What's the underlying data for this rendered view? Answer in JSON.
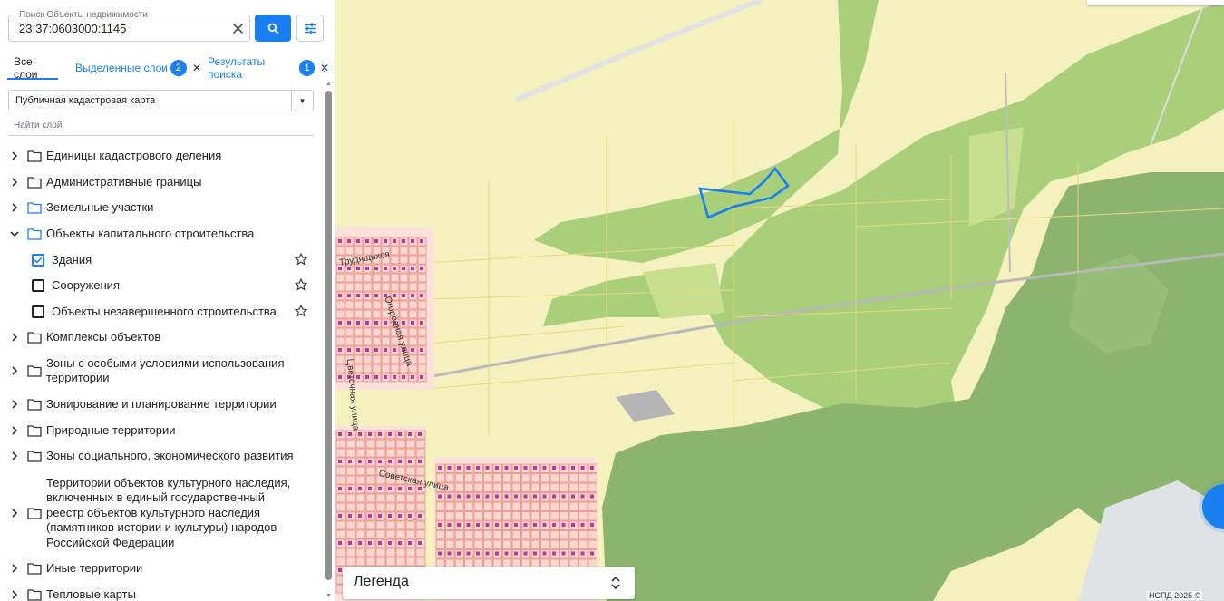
{
  "search": {
    "label": "Поиск Объекты недвижимости",
    "value": "23:37:0603000:1145"
  },
  "tabs": [
    {
      "label": "Все слои"
    },
    {
      "label": "Выделенные слои",
      "badge": "2"
    },
    {
      "label": "Результаты поиска",
      "badge": "1"
    }
  ],
  "tab_close": "✕",
  "tabs_more": "›",
  "map_select": {
    "value": "Публичная кадастровая карта"
  },
  "layer_search": {
    "placeholder": "Найти слой"
  },
  "tree": {
    "items": [
      {
        "label": "Единицы кадастрового деления"
      },
      {
        "label": "Административные границы"
      },
      {
        "label": "Земельные участки",
        "folder_color": "#1a7ff0"
      },
      {
        "label": "Объекты капитального строительства",
        "folder_color": "#1a7ff0",
        "expanded": true
      },
      {
        "label": "Комплексы объектов"
      },
      {
        "label": "Зоны с особыми условиями использования территории"
      },
      {
        "label": "Зонирование и планирование территории"
      },
      {
        "label": "Природные территории"
      },
      {
        "label": "Зоны социального, экономического развития"
      },
      {
        "label": "Территории объектов культурного наследия, включенных в единый государственный реестр объектов культурного наследия (памятников истории и культуры) народов Российской Федерации"
      },
      {
        "label": "Иные территории"
      },
      {
        "label": "Тепловые карты"
      }
    ],
    "children": [
      {
        "label": "Здания",
        "checked": true
      },
      {
        "label": "Сооружения",
        "checked": false
      },
      {
        "label": "Объекты незавершенного строительства",
        "checked": false
      }
    ]
  },
  "map": {
    "streets": [
      {
        "label": "Трудящихся"
      },
      {
        "label": "Огородная улица"
      },
      {
        "label": "Цветочная улица"
      },
      {
        "label": "Советская улица"
      }
    ],
    "colors": {
      "land": "#f4f1bf",
      "forest_light": "#a9cf7b",
      "forest_dark": "#8db46e",
      "parcel_line": "#e6d97a",
      "building_fill": "#fcd6cf",
      "building_line": "#e0756a",
      "building_dot": "#c2359e",
      "highlight": "#1a7ff0",
      "road": "#d8d8d8"
    }
  },
  "legend": {
    "label": "Легенда"
  },
  "copyright": "НСПД 2025 ©"
}
